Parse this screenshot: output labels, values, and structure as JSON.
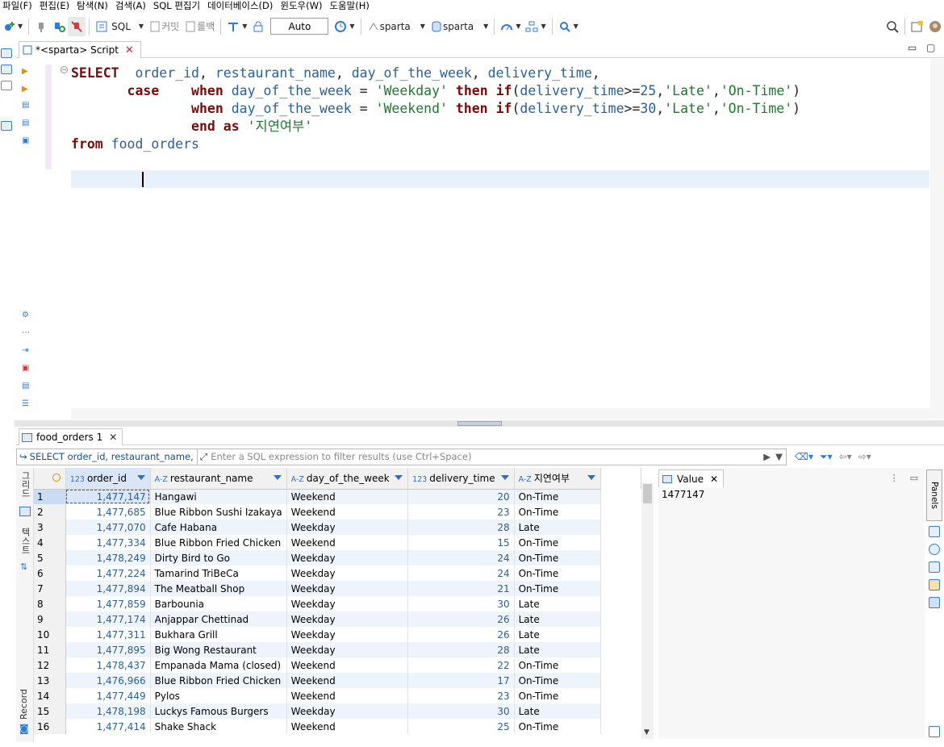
{
  "menu": [
    "파일(F)",
    "편집(E)",
    "탐색(N)",
    "검색(A)",
    "SQL 편집기",
    "데이터베이스(D)",
    "윈도우(W)",
    "도움말(H)"
  ],
  "toolbar": {
    "sql_label": "SQL",
    "commit_label": "커밋",
    "rollback_label": "롤백",
    "transaction_mode": "Auto",
    "datasource": "sparta",
    "schema": "sparta"
  },
  "editor": {
    "tab_title": "*<sparta> Script",
    "lines": [
      [
        [
          "kw",
          "SELECT"
        ],
        [
          "plain",
          "  "
        ],
        [
          "id",
          "order_id"
        ],
        [
          "plain",
          ", "
        ],
        [
          "id",
          "restaurant_name"
        ],
        [
          "plain",
          ", "
        ],
        [
          "id",
          "day_of_the_week"
        ],
        [
          "plain",
          ", "
        ],
        [
          "id",
          "delivery_time"
        ],
        [
          "plain",
          ","
        ]
      ],
      [
        [
          "plain",
          "       "
        ],
        [
          "kw",
          "case"
        ],
        [
          "plain",
          "    "
        ],
        [
          "kw",
          "when"
        ],
        [
          "plain",
          " "
        ],
        [
          "id",
          "day_of_the_week"
        ],
        [
          "plain",
          " = "
        ],
        [
          "str",
          "'Weekday'"
        ],
        [
          "plain",
          " "
        ],
        [
          "kw",
          "then"
        ],
        [
          "plain",
          " "
        ],
        [
          "kw",
          "if"
        ],
        [
          "plain",
          "("
        ],
        [
          "id",
          "delivery_time"
        ],
        [
          "plain",
          ">="
        ],
        [
          "num",
          "25"
        ],
        [
          "plain",
          ","
        ],
        [
          "str",
          "'Late'"
        ],
        [
          "plain",
          ","
        ],
        [
          "str",
          "'On-Time'"
        ],
        [
          "plain",
          ")"
        ]
      ],
      [
        [
          "plain",
          "               "
        ],
        [
          "kw",
          "when"
        ],
        [
          "plain",
          " "
        ],
        [
          "id",
          "day_of_the_week"
        ],
        [
          "plain",
          " = "
        ],
        [
          "str",
          "'Weekend'"
        ],
        [
          "plain",
          " "
        ],
        [
          "kw",
          "then"
        ],
        [
          "plain",
          " "
        ],
        [
          "kw",
          "if"
        ],
        [
          "plain",
          "("
        ],
        [
          "id",
          "delivery_time"
        ],
        [
          "plain",
          ">="
        ],
        [
          "num",
          "30"
        ],
        [
          "plain",
          ","
        ],
        [
          "str",
          "'Late'"
        ],
        [
          "plain",
          ","
        ],
        [
          "str",
          "'On-Time'"
        ],
        [
          "plain",
          ")"
        ]
      ],
      [
        [
          "plain",
          "               "
        ],
        [
          "kw",
          "end"
        ],
        [
          "plain",
          " "
        ],
        [
          "kw",
          "as"
        ],
        [
          "plain",
          " "
        ],
        [
          "str",
          "'지연여부'"
        ]
      ],
      [
        [
          "kw",
          "from"
        ],
        [
          "plain",
          " "
        ],
        [
          "id",
          "food_orders"
        ]
      ]
    ]
  },
  "results": {
    "tab_title": "food_orders 1",
    "query_preview": "SELECT order_id, restaurant_name, da",
    "filter_placeholder": "Enter a SQL expression to filter results (use Ctrl+Space)",
    "side_tab_grid": "그리드",
    "side_tab_text": "텍스트",
    "side_tab_record": "Record",
    "columns": [
      {
        "type": "123",
        "name": "order_id"
      },
      {
        "type": "A-Z",
        "name": "restaurant_name"
      },
      {
        "type": "A-Z",
        "name": "day_of_the_week"
      },
      {
        "type": "123",
        "name": "delivery_time"
      },
      {
        "type": "A-Z",
        "name": "지연여부"
      }
    ],
    "rows": [
      [
        "1",
        "1,477,147",
        "Hangawi",
        "Weekend",
        "20",
        "On-Time"
      ],
      [
        "2",
        "1,477,685",
        "Blue Ribbon Sushi Izakaya",
        "Weekend",
        "23",
        "On-Time"
      ],
      [
        "3",
        "1,477,070",
        "Cafe Habana",
        "Weekday",
        "28",
        "Late"
      ],
      [
        "4",
        "1,477,334",
        "Blue Ribbon Fried Chicken",
        "Weekend",
        "15",
        "On-Time"
      ],
      [
        "5",
        "1,478,249",
        "Dirty Bird to Go",
        "Weekday",
        "24",
        "On-Time"
      ],
      [
        "6",
        "1,477,224",
        "Tamarind TriBeCa",
        "Weekday",
        "24",
        "On-Time"
      ],
      [
        "7",
        "1,477,894",
        "The Meatball Shop",
        "Weekday",
        "21",
        "On-Time"
      ],
      [
        "8",
        "1,477,859",
        "Barbounia",
        "Weekday",
        "30",
        "Late"
      ],
      [
        "9",
        "1,477,174",
        "Anjappar Chettinad",
        "Weekday",
        "26",
        "Late"
      ],
      [
        "10",
        "1,477,311",
        "Bukhara Grill",
        "Weekday",
        "26",
        "Late"
      ],
      [
        "11",
        "1,477,895",
        "Big Wong Restaurant",
        "Weekday",
        "28",
        "Late"
      ],
      [
        "12",
        "1,478,437",
        "Empanada Mama (closed)",
        "Weekend",
        "22",
        "On-Time"
      ],
      [
        "13",
        "1,476,966",
        "Blue Ribbon Fried Chicken",
        "Weekend",
        "17",
        "On-Time"
      ],
      [
        "14",
        "1,477,449",
        "Pylos",
        "Weekend",
        "23",
        "On-Time"
      ],
      [
        "15",
        "1,478,198",
        "Luckys Famous Burgers",
        "Weekday",
        "30",
        "Late"
      ],
      [
        "16",
        "1,477,414",
        "Shake Shack",
        "Weekend",
        "25",
        "On-Time"
      ]
    ]
  },
  "value_panel": {
    "tab_title": "Value",
    "value": "1477147",
    "panels_label": "Panels"
  }
}
